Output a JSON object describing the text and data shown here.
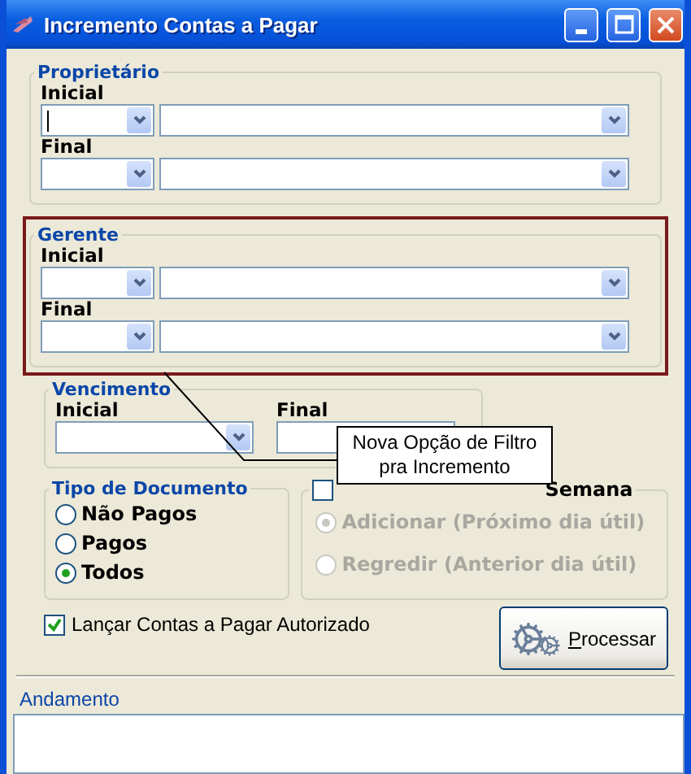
{
  "window": {
    "title": "Incremento Contas a Pagar"
  },
  "filter_groups": [
    {
      "title": "Proprietário",
      "highlighted": false,
      "rows": [
        {
          "label": "Inicial",
          "focused": true
        },
        {
          "label": "Final",
          "focused": false
        }
      ]
    },
    {
      "title": "Gerente",
      "highlighted": true,
      "rows": [
        {
          "label": "Inicial",
          "focused": false
        },
        {
          "label": "Final",
          "focused": false
        }
      ]
    }
  ],
  "vencimento": {
    "title": "Vencimento",
    "fields": [
      {
        "label": "Inicial"
      },
      {
        "label": "Final"
      }
    ]
  },
  "callout": {
    "text": "Nova Opção de Filtro\npra Incremento"
  },
  "tipo_documento": {
    "title": "Tipo de Documento",
    "options": [
      {
        "label": "Não Pagos",
        "selected": false
      },
      {
        "label": "Pagos",
        "selected": false
      },
      {
        "label": "Todos",
        "selected": true
      }
    ]
  },
  "fim_de_semana": {
    "label": "Semana",
    "checked": false,
    "disabled": true,
    "options": [
      {
        "label": "Adicionar (Próximo dia útil)",
        "selected": true
      },
      {
        "label": "Regredir (Anterior dia útil)",
        "selected": false
      }
    ]
  },
  "autorizado": {
    "label": "Lançar Contas a Pagar Autorizado",
    "checked": true
  },
  "process_button": {
    "label": "Processar"
  },
  "andamento": {
    "label": "Andamento"
  }
}
